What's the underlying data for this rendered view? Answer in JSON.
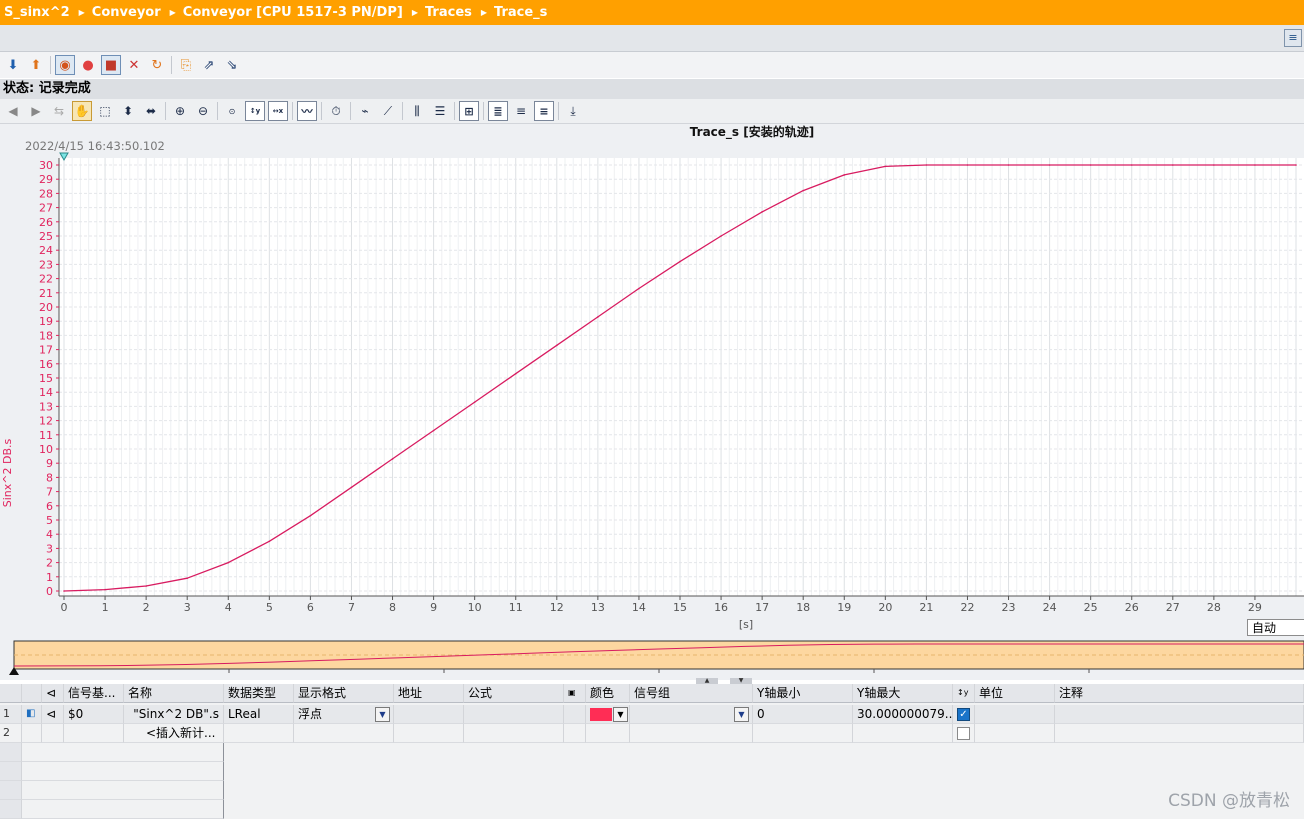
{
  "breadcrumb": [
    "S_sinx^2",
    "Conveyor",
    "Conveyor [CPU 1517-3 PN/DP]",
    "Traces",
    "Trace_s"
  ],
  "status": "状态: 记录完成",
  "timestamp": "2022/4/15 16:43:50.102",
  "x_unit_dropdown": "自动",
  "table": {
    "headers": {
      "signal_base": "信号基...",
      "name": "名称",
      "data_type": "数据类型",
      "display_format": "显示格式",
      "address": "地址",
      "formula": "公式",
      "color": "颜色",
      "signal_group": "信号组",
      "y_min": "Y轴最小",
      "y_max": "Y轴最大",
      "unit": "单位",
      "comment": "注释"
    },
    "rows": [
      {
        "num": "1",
        "signal_base": "$0",
        "name": "\"Sinx^2 DB\".s",
        "data_type": "LReal",
        "display_format": "浮点",
        "address": "",
        "formula": "",
        "color": "#ff2d55",
        "signal_group": "",
        "y_min": "0",
        "y_max": "30.000000079...",
        "scale_100": true
      },
      {
        "num": "2",
        "insert_label": "<插入新计..."
      }
    ]
  },
  "watermark": "CSDN @放青松",
  "chart_data": {
    "type": "line",
    "title": "Trace_s [安装的轨迹]",
    "xlabel": "[s]",
    "ylabel": "Sinx^2 DB.s",
    "xlim": [
      0,
      30
    ],
    "ylim": [
      0,
      30
    ],
    "x_ticks": [
      0,
      1,
      2,
      3,
      4,
      5,
      6,
      7,
      8,
      9,
      10,
      11,
      12,
      13,
      14,
      15,
      16,
      17,
      18,
      19,
      20,
      21,
      22,
      23,
      24,
      25,
      26,
      27,
      28,
      29
    ],
    "y_ticks": [
      0,
      1,
      2,
      3,
      4,
      5,
      6,
      7,
      8,
      9,
      10,
      11,
      12,
      13,
      14,
      15,
      16,
      17,
      18,
      19,
      20,
      21,
      22,
      23,
      24,
      25,
      26,
      27,
      28,
      29,
      30
    ],
    "grid": true,
    "series": [
      {
        "color": "#d81b60",
        "x": [
          0,
          1,
          2,
          3,
          4,
          5,
          6,
          7,
          8,
          9,
          10,
          11,
          12,
          13,
          14,
          15,
          16,
          17,
          18,
          19,
          20,
          21,
          22,
          23,
          24,
          25,
          26,
          27,
          28,
          29,
          30
        ],
        "y": [
          0,
          0.1,
          0.35,
          0.9,
          2.0,
          3.5,
          5.3,
          7.3,
          9.3,
          11.3,
          13.3,
          15.3,
          17.3,
          19.3,
          21.3,
          23.2,
          25.0,
          26.7,
          28.2,
          29.3,
          29.9,
          30,
          30,
          30,
          30,
          30,
          30,
          30,
          30,
          30,
          30
        ]
      }
    ]
  }
}
